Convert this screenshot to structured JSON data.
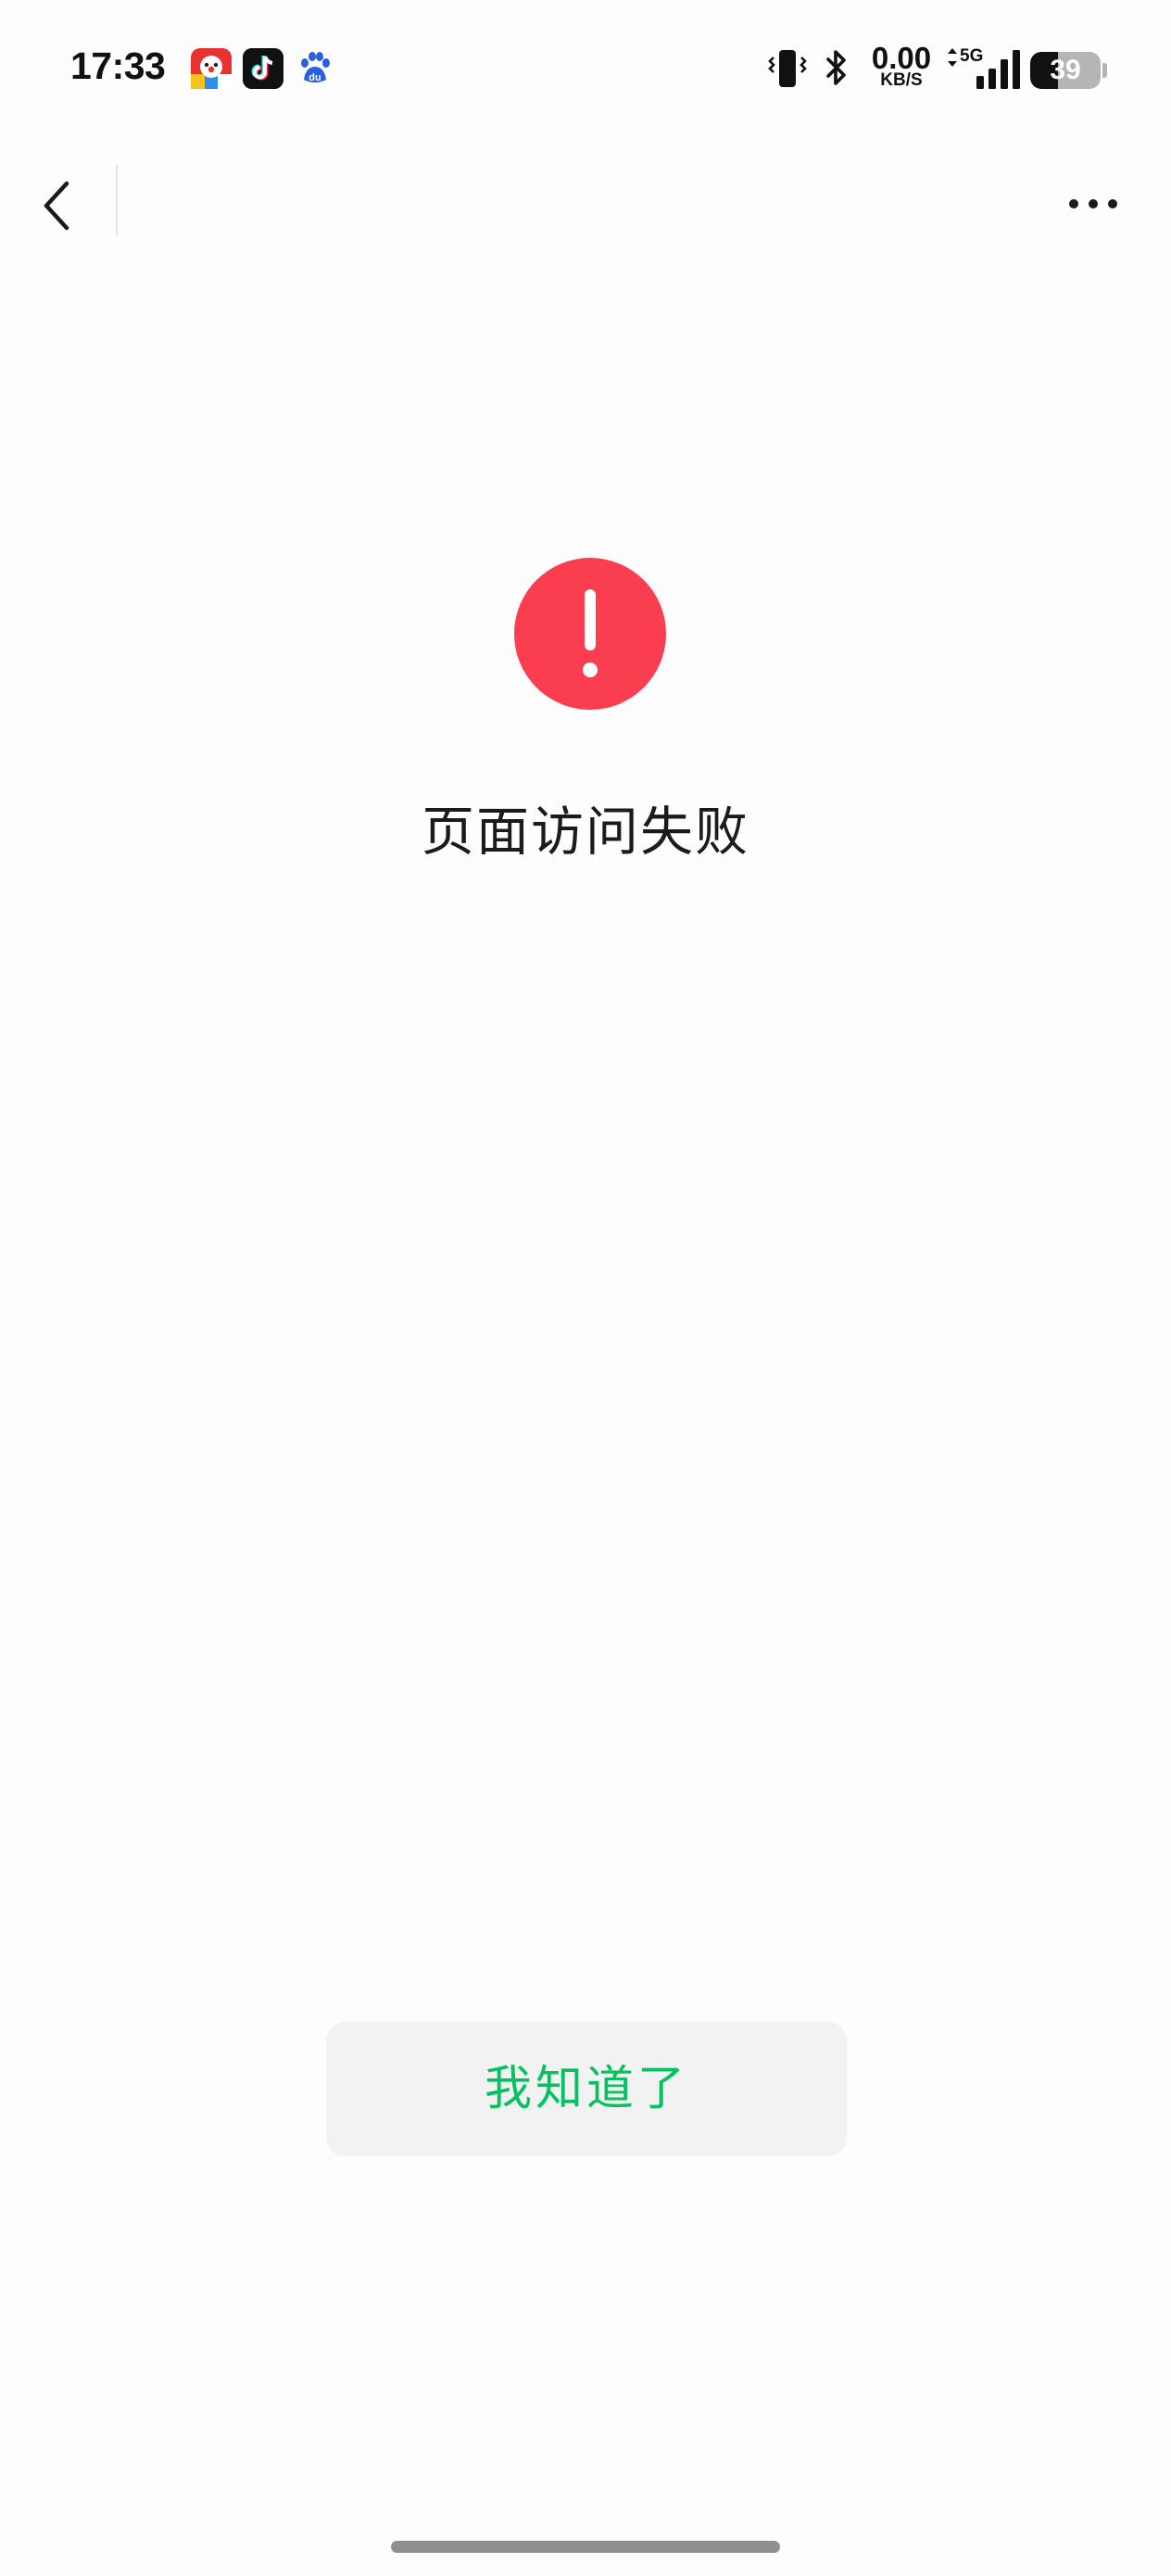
{
  "status_bar": {
    "time": "17:33",
    "notification_icons": [
      "clown-app-icon",
      "tiktok-icon",
      "baidu-icon"
    ],
    "net_speed_value": "0.00",
    "net_speed_unit": "KB/S",
    "network_type": "5G",
    "battery_level": "39",
    "battery_fraction": 0.39
  },
  "nav": {
    "back_icon": "chevron-left-icon",
    "more_icon": "more-dots-icon"
  },
  "error": {
    "icon": "exclamation-circle-icon",
    "icon_color": "#fa3e4f",
    "title": "页面访问失败"
  },
  "actions": {
    "confirm_label": "我知道了",
    "confirm_color": "#07c160"
  }
}
